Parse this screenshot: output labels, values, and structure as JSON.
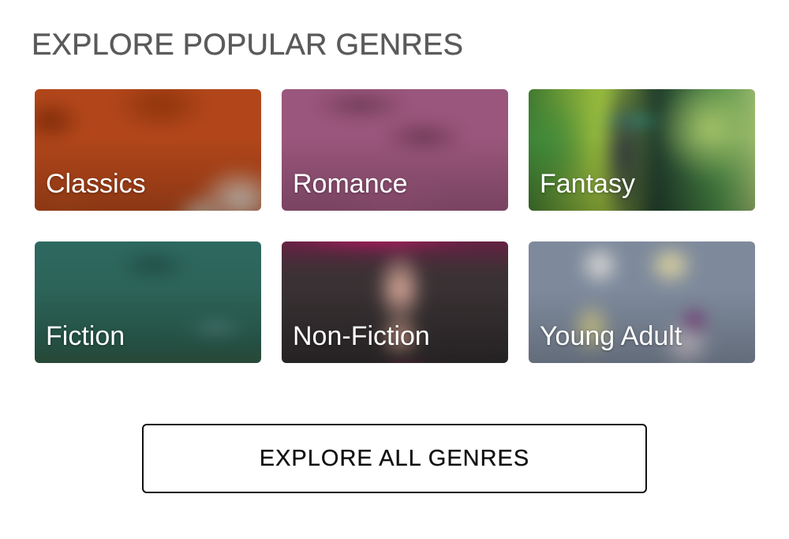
{
  "section": {
    "title": "EXPLORE POPULAR GENRES"
  },
  "genres": [
    {
      "label": "Classics"
    },
    {
      "label": "Romance"
    },
    {
      "label": "Fantasy"
    },
    {
      "label": "Fiction"
    },
    {
      "label": "Non-Fiction"
    },
    {
      "label": "Young Adult"
    }
  ],
  "cta": {
    "label": "EXPLORE ALL GENRES"
  }
}
